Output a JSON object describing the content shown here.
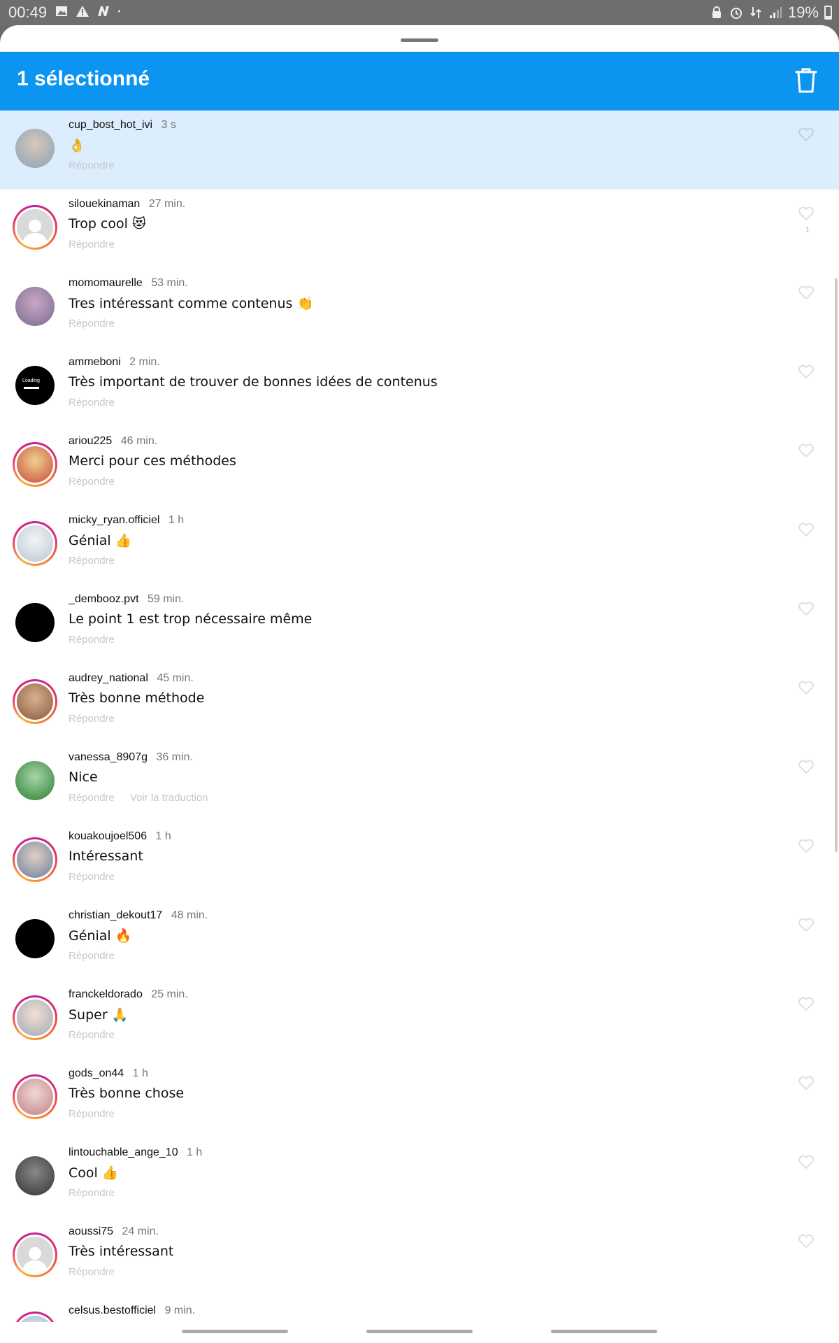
{
  "status_bar": {
    "time": "00:49",
    "battery": "19%",
    "left_icons": [
      "image-icon",
      "warning-icon",
      "n-logo-icon",
      "dot-icon"
    ],
    "right_icons": [
      "lock-icon",
      "alarm-icon",
      "data-arrows-icon",
      "signal-icon"
    ]
  },
  "header": {
    "title": "1 sélectionné",
    "delete_icon": "trash-icon"
  },
  "colors": {
    "header_bg": "#0b95f0",
    "selected_bg": "#dceefe",
    "story_ring": "#e1306c"
  },
  "reply_label": "Répondre",
  "comments": [
    {
      "user": "cup_bost_hot_ivi",
      "time": "3 s",
      "text": "👌",
      "selected": true,
      "ring": false,
      "actions": [
        "Répondre"
      ]
    },
    {
      "user": "silouekinaman",
      "time": "27 min.",
      "text": "Trop cool 😻",
      "ring": true,
      "likes": "1",
      "actions": [
        "Répondre"
      ]
    },
    {
      "user": "momomaurelle",
      "time": "53 min.",
      "text": "Tres intéressant comme contenus 👏",
      "ring": false,
      "actions": [
        "Répondre"
      ]
    },
    {
      "user": "ammeboni",
      "time": "2 min.",
      "text": "Très important de trouver de bonnes idées de contenus",
      "ring": false,
      "avatar_text": "Loading",
      "actions": [
        "Répondre"
      ]
    },
    {
      "user": "ariou225",
      "time": "46 min.",
      "text": "Merci pour ces méthodes",
      "ring": true,
      "actions": [
        "Répondre"
      ]
    },
    {
      "user": "micky_ryan.officiel",
      "time": "1 h",
      "text": "Génial 👍",
      "ring": true,
      "actions": [
        "Répondre"
      ]
    },
    {
      "user": "_dembooz.pvt",
      "time": "59 min.",
      "text": "Le point 1 est trop nécessaire même",
      "ring": false,
      "actions": [
        "Répondre"
      ]
    },
    {
      "user": "audrey_national",
      "time": "45 min.",
      "text": "Très bonne méthode",
      "ring": true,
      "actions": [
        "Répondre"
      ]
    },
    {
      "user": "vanessa_8907g",
      "time": "36 min.",
      "text": "Nice",
      "ring": false,
      "actions": [
        "Répondre",
        "Voir la traduction"
      ]
    },
    {
      "user": "kouakoujoel506",
      "time": "1 h",
      "text": "Intéressant",
      "ring": true,
      "actions": [
        "Répondre"
      ]
    },
    {
      "user": "christian_dekout17",
      "time": "48 min.",
      "text": "Génial 🔥",
      "ring": false,
      "actions": [
        "Répondre"
      ]
    },
    {
      "user": "franckeldorado",
      "time": "25 min.",
      "text": "Super 🙏",
      "ring": true,
      "actions": [
        "Répondre"
      ]
    },
    {
      "user": "gods_on44",
      "time": "1 h",
      "text": "Très bonne chose",
      "ring": true,
      "actions": [
        "Répondre"
      ]
    },
    {
      "user": "lintouchable_ange_10",
      "time": "1 h",
      "text": "Cool 👍",
      "ring": false,
      "actions": [
        "Répondre"
      ]
    },
    {
      "user": "aoussi75",
      "time": "24 min.",
      "text": "Très intéressant",
      "ring": true,
      "actions": [
        "Répondre"
      ]
    },
    {
      "user": "celsus.bestofficiel",
      "time": "9 min.",
      "text": "",
      "ring": true,
      "actions": []
    }
  ]
}
